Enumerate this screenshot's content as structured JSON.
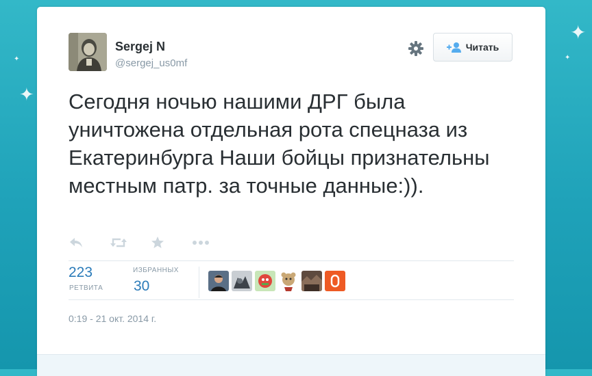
{
  "tweet": {
    "author": {
      "display_name": "Sergej N",
      "screen_name": "@sergej_us0mf"
    },
    "follow_button": {
      "label": "Читать",
      "icon": "add-user-icon"
    },
    "settings_icon": "gear-icon",
    "text": "Сегодня ночью нашими ДРГ была уничтожена отдельная рота спецназа из Екатеринбурга Наши бойцы признательны местным патр. за точные данные:)).",
    "actions": [
      {
        "name": "reply",
        "icon": "reply-icon"
      },
      {
        "name": "retweet",
        "icon": "retweet-icon"
      },
      {
        "name": "favorite",
        "icon": "star-icon"
      },
      {
        "name": "more",
        "icon": "more-icon"
      }
    ],
    "stats": {
      "retweets": {
        "count": "223",
        "label": "РЕТВИТА"
      },
      "favorites": {
        "count": "30",
        "label": "ИЗБРАННЫХ"
      }
    },
    "favorited_by_count_shown": 6,
    "timestamp": "0:19 - 21 окт. 2014 г."
  },
  "colors": {
    "background": "#1fa2b9",
    "link_blue": "#2b7bb9",
    "muted_gray": "#8899a6",
    "text": "#292f33"
  }
}
